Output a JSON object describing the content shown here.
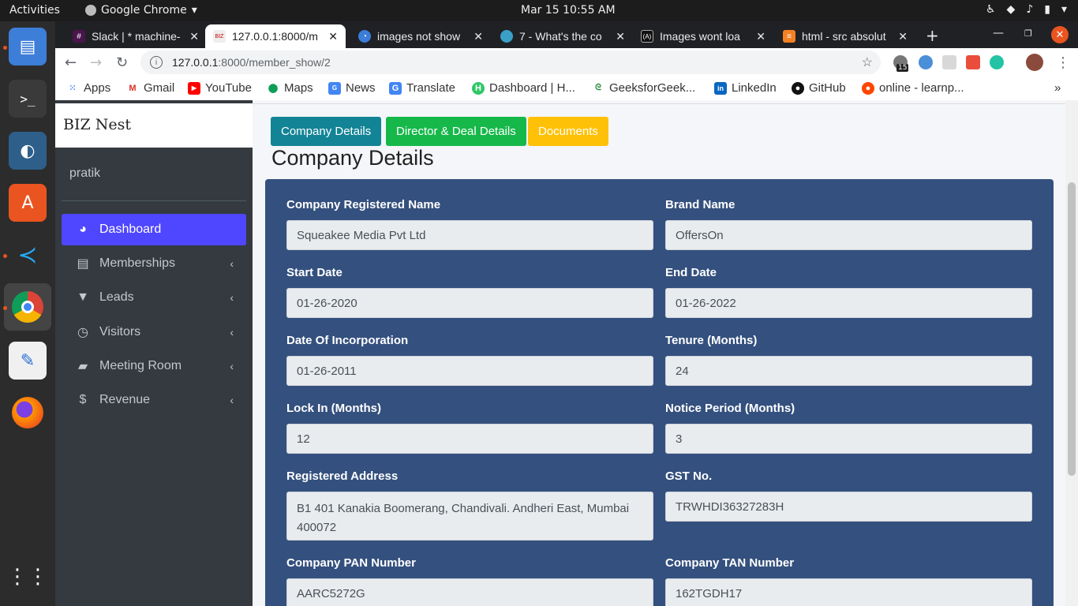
{
  "os": {
    "activities": "Activities",
    "app_name": "Google Chrome",
    "clock": "Mar 15  10:55 AM"
  },
  "tabs": [
    {
      "title": "Slack | * machine-",
      "icon": "slack-icon"
    },
    {
      "title": "127.0.0.1:8000/m",
      "icon": "biznest-icon"
    },
    {
      "title": "images not show",
      "icon": "stackoverflow-icon"
    },
    {
      "title": "7 - What's the co",
      "icon": "drop-icon"
    },
    {
      "title": "Images wont loa",
      "icon": "code-icon"
    },
    {
      "title": "html - src absolut",
      "icon": "stackoverflow-icon"
    }
  ],
  "address": {
    "host": "127.0.0.1",
    "path": ":8000/member_show/2",
    "extension_badge": "15"
  },
  "bookmarks": [
    {
      "label": "Apps",
      "icon": "apps-grid-icon"
    },
    {
      "label": "Gmail",
      "icon": "gmail-icon"
    },
    {
      "label": "YouTube",
      "icon": "youtube-icon"
    },
    {
      "label": "Maps",
      "icon": "maps-icon"
    },
    {
      "label": "News",
      "icon": "news-icon"
    },
    {
      "label": "Translate",
      "icon": "translate-icon"
    },
    {
      "label": "Dashboard | H...",
      "icon": "hackerrank-icon"
    },
    {
      "label": "GeeksforGeek...",
      "icon": "gfg-icon"
    },
    {
      "label": "LinkedIn",
      "icon": "linkedin-icon"
    },
    {
      "label": "GitHub",
      "icon": "github-icon"
    },
    {
      "label": "online - learnp...",
      "icon": "reddit-icon"
    }
  ],
  "sidebar": {
    "brand_prefix": "BIZ",
    "brand_suffix": " Nest",
    "user": "pratik",
    "items": [
      {
        "label": "Dashboard",
        "icon": "dashboard-gauge-icon",
        "active": true
      },
      {
        "label": "Memberships",
        "icon": "id-card-icon"
      },
      {
        "label": "Leads",
        "icon": "filter-icon"
      },
      {
        "label": "Visitors",
        "icon": "clock-icon"
      },
      {
        "label": "Meeting Room",
        "icon": "book-icon"
      },
      {
        "label": "Revenue",
        "icon": "dollar-icon"
      }
    ]
  },
  "tabs_buttons": {
    "company": "Company Details",
    "director": "Director & Deal Details",
    "documents": "Documents"
  },
  "page_title": "Company Details",
  "form": {
    "company_name": {
      "label": "Company Registered Name",
      "value": "Squeakee Media Pvt Ltd"
    },
    "brand_name": {
      "label": "Brand Name",
      "value": "OffersOn"
    },
    "start_date": {
      "label": "Start Date",
      "value": "01-26-2020"
    },
    "end_date": {
      "label": "End Date",
      "value": "01-26-2022"
    },
    "incorporation": {
      "label": "Date Of Incorporation",
      "value": "01-26-2011"
    },
    "tenure": {
      "label": "Tenure (Months)",
      "value": "24"
    },
    "lock_in": {
      "label": "Lock In (Months)",
      "value": "12"
    },
    "notice": {
      "label": "Notice Period (Months)",
      "value": "3"
    },
    "address": {
      "label": "Registered Address",
      "value": "B1 401 Kanakia Boomerang, Chandivali. Andheri East, Mumbai 400072"
    },
    "gst": {
      "label": "GST No.",
      "value": "TRWHDI36327283H"
    },
    "pan": {
      "label": "Company PAN Number",
      "value": "AARC5272G"
    },
    "tan": {
      "label": "Company TAN Number",
      "value": "162TGDH17"
    }
  },
  "colors": {
    "card": "#34507e",
    "btn_company": "#138496",
    "btn_director": "#17b84a",
    "btn_documents": "#ffc107",
    "sidebar_active": "#4f46ff"
  }
}
